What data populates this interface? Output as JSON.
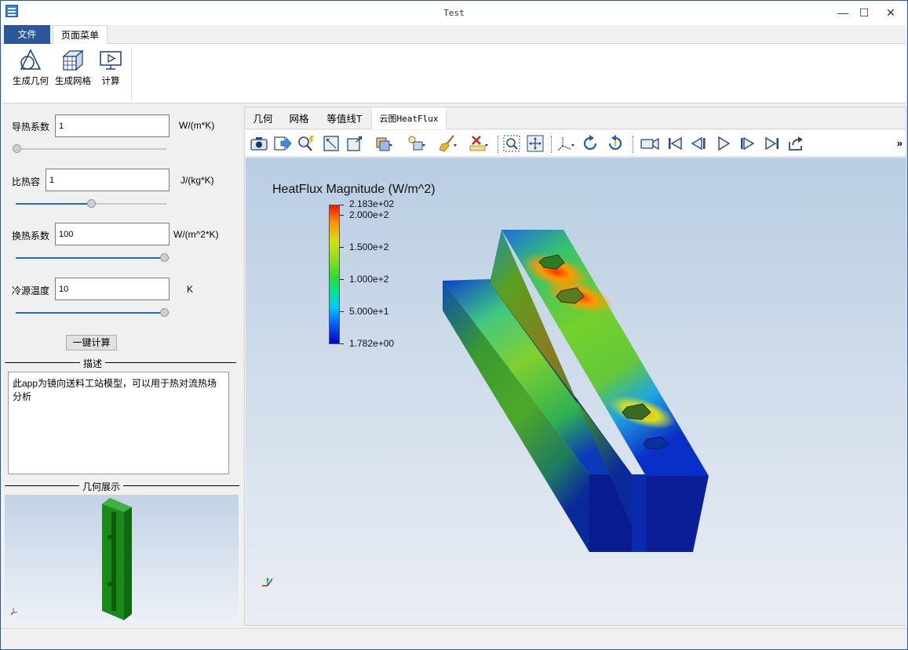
{
  "window": {
    "title": "Test"
  },
  "ribbon": {
    "tabs": [
      "文件",
      "页面菜单"
    ],
    "buttons": [
      {
        "label": "生成几何",
        "icon": "geometry-shapes-icon"
      },
      {
        "label": "生成网格",
        "icon": "mesh-cube-icon"
      },
      {
        "label": "计算",
        "icon": "monitor-play-icon"
      }
    ]
  },
  "params": {
    "thermal_conductivity": {
      "label": "导热系数",
      "value": "1",
      "unit": "W/(m*K)",
      "slider": 0.0
    },
    "specific_heat": {
      "label": "比热容",
      "value": "1",
      "unit": "J/(kg*K)",
      "slider": 0.5
    },
    "heat_transfer_coeff": {
      "label": "换热系数",
      "value": "100",
      "unit": "W/(m^2*K)",
      "slider": 1.0
    },
    "cold_source_temp": {
      "label": "冷源温度",
      "value": "10",
      "unit": "K",
      "slider": 1.0
    }
  },
  "calc_button": "一键计算",
  "description": {
    "title": "描述",
    "text": "此app为镜向送料工站模型，可以用于热对流热场分析"
  },
  "geometry_preview": {
    "title": "几何展示"
  },
  "view_tabs": [
    "几何",
    "网格",
    "等值线T",
    "云图HeatFlux"
  ],
  "colorbar": {
    "title": "HeatFlux Magnitude (W/m^2)",
    "labels": [
      "2.183e+02",
      "2.000e+2",
      "1.500e+2",
      "1.000e+2",
      "5.000e+1",
      "1.782e+00"
    ]
  }
}
